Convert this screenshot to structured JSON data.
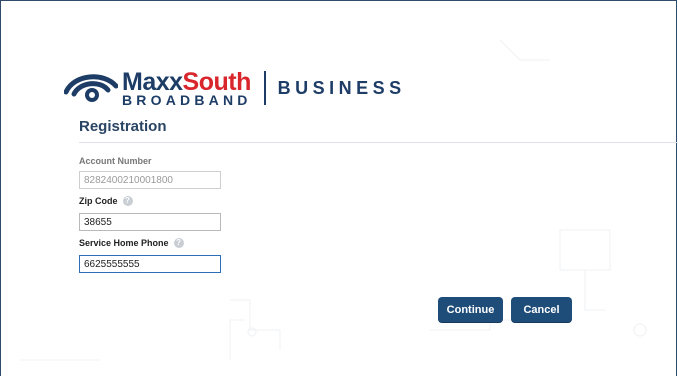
{
  "brand": {
    "name_part1": "Maxx",
    "name_part2": "South",
    "subline": "BROADBAND",
    "division": "BUSINESS",
    "colors": {
      "navy": "#1d3d66",
      "red": "#d8262c"
    }
  },
  "page": {
    "title": "Registration"
  },
  "form": {
    "account_number": {
      "label": "Account Number",
      "value": "8282400210001800"
    },
    "zip_code": {
      "label": "Zip Code",
      "value": "38655",
      "help_icon": "help-icon"
    },
    "service_phone": {
      "label": "Service Home Phone",
      "value": "6625555555",
      "help_icon": "help-icon"
    }
  },
  "actions": {
    "continue_label": "Continue",
    "cancel_label": "Cancel",
    "button_color": "#1f4d7a"
  }
}
